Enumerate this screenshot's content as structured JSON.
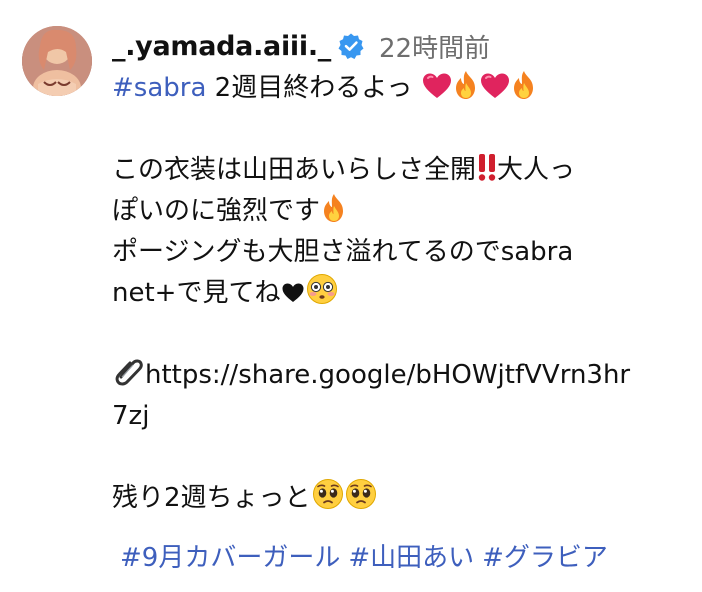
{
  "post": {
    "username": "_.yamada.aiii._",
    "verified": true,
    "timestamp": "22時間前",
    "caption": {
      "line1": {
        "hashtag": "#sabra",
        "text": " 2週目終わるよっ"
      },
      "line1_emoji": [
        "red-heart",
        "fire",
        "red-heart",
        "fire"
      ],
      "line2": {
        "text": "この衣装は山田あいらしさ全開",
        "emoji_after": "double-exclamation",
        "text2": "大人っ"
      },
      "line3": {
        "text": "ぽいのに強烈です",
        "emoji_after": "fire"
      },
      "line4": {
        "text": "ポージングも大胆さ溢れてるのでsabra"
      },
      "line5": {
        "text": "net+で見てね",
        "emoji_after": [
          "black-heart-suit",
          "flushed-face"
        ]
      },
      "link": {
        "icon": "paperclip",
        "text_line1": "https://share.google/bHOWjtfVVrn3hr",
        "text_line2": "7zj"
      },
      "line8": {
        "text": "残り2週ちょっと",
        "emoji_after": [
          "pleading-face",
          "pleading-face"
        ]
      }
    },
    "hashtags": [
      "#9月カバーガール",
      "#山田あい",
      "#グラビア"
    ]
  },
  "colors": {
    "text": "#111111",
    "timestamp": "#6e6e6e",
    "hashtag": "#3e5fbd",
    "verified_badge": "#3897f0",
    "heart": "#e0245e",
    "fire": "#f58220"
  }
}
